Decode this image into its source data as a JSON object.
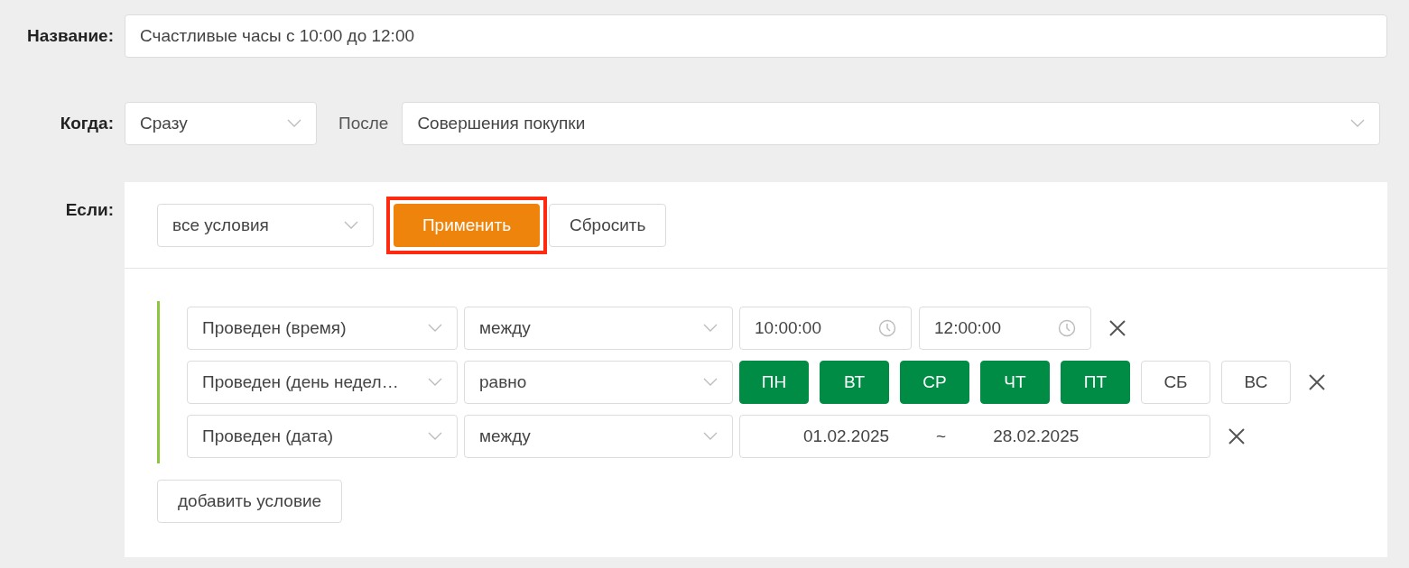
{
  "name_row": {
    "label": "Название:",
    "value": "Счастливые часы с 10:00 до 12:00"
  },
  "when_row": {
    "label": "Когда:",
    "timing": "Сразу",
    "after_label": "После",
    "event": "Совершения покупки"
  },
  "if_row": {
    "label": "Если:",
    "match": "все условия",
    "apply_button": {
      "label": "Применить",
      "highlighted": true
    },
    "reset_button": {
      "label": "Сбросить"
    },
    "conditions": [
      {
        "kind": "time_range",
        "field": "Проведен (время)",
        "operator": "между",
        "from": "10:00:00",
        "to": "12:00:00"
      },
      {
        "kind": "weekdays",
        "field": "Проведен (день недел…",
        "operator": "равно",
        "days": [
          {
            "label": "ПН",
            "selected": true
          },
          {
            "label": "ВТ",
            "selected": true
          },
          {
            "label": "СР",
            "selected": true
          },
          {
            "label": "ЧТ",
            "selected": true
          },
          {
            "label": "ПТ",
            "selected": true
          },
          {
            "label": "СБ",
            "selected": false
          },
          {
            "label": "ВС",
            "selected": false
          }
        ]
      },
      {
        "kind": "date_range",
        "field": "Проведен (дата)",
        "operator": "между",
        "from": "01.02.2025",
        "separator": "~",
        "to": "28.02.2025"
      }
    ],
    "add_button": "добавить условие"
  }
}
